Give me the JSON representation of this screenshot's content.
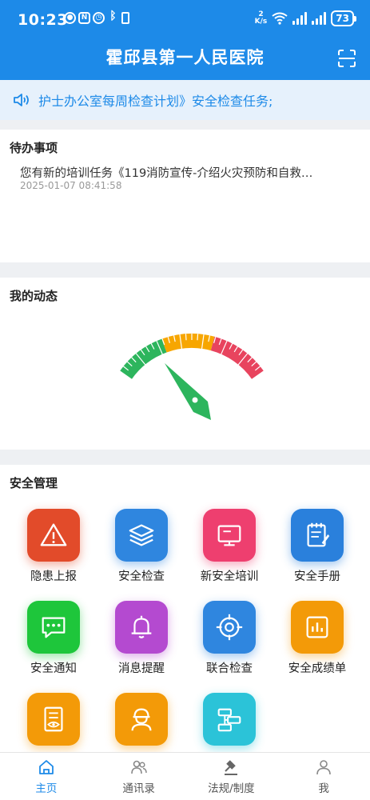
{
  "status_bar": {
    "time": "10:23",
    "speed_top": "2",
    "speed_bottom": "K/s",
    "battery": "73"
  },
  "header": {
    "title": "霍邱县第一人民医院"
  },
  "notice": {
    "text": "护士办公室每周检查计划》安全检查任务;"
  },
  "todo": {
    "title": "待办事项",
    "items": [
      {
        "text": "您有新的培训任务《119消防宣传-介绍火灾预防和自救…",
        "time": "2025-01-07 08:41:58"
      }
    ]
  },
  "dynamics": {
    "title": "我的动态",
    "gauge_colors": {
      "green": "#2db55d",
      "orange": "#f7a600",
      "red": "#e8445e",
      "needle": "#2db55d"
    }
  },
  "safety": {
    "title": "安全管理",
    "items": [
      {
        "label": "隐患上报",
        "color": "#e24b2a",
        "icon": "warning-icon"
      },
      {
        "label": "安全检查",
        "color": "#2f86df",
        "icon": "layers-icon"
      },
      {
        "label": "新安全培训",
        "color": "#ee3f6f",
        "icon": "monitor-icon"
      },
      {
        "label": "安全手册",
        "color": "#2a80dc",
        "icon": "notebook-icon"
      },
      {
        "label": "安全通知",
        "color": "#1ec63b",
        "icon": "chat-icon"
      },
      {
        "label": "消息提醒",
        "color": "#b44ad0",
        "icon": "bell-icon"
      },
      {
        "label": "联合检查",
        "color": "#2f86df",
        "icon": "target-icon"
      },
      {
        "label": "安全成绩单",
        "color": "#f39a08",
        "icon": "chart-icon"
      },
      {
        "label": "",
        "color": "#f39a08",
        "icon": "document-eye-icon"
      },
      {
        "label": "",
        "color": "#f39a08",
        "icon": "worker-icon"
      },
      {
        "label": "",
        "color": "#2bc3d8",
        "icon": "flowchart-icon"
      }
    ]
  },
  "tabbar": {
    "items": [
      {
        "label": "主页",
        "icon": "home-icon"
      },
      {
        "label": "通讯录",
        "icon": "contacts-icon"
      },
      {
        "label": "法规/制度",
        "icon": "gavel-icon"
      },
      {
        "label": "我",
        "icon": "person-icon"
      }
    ]
  }
}
